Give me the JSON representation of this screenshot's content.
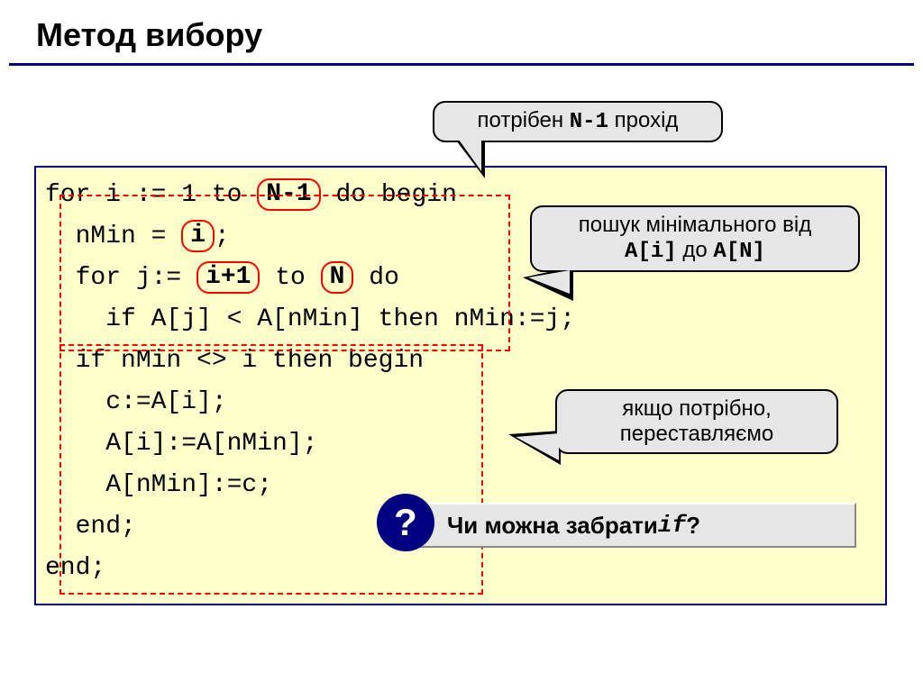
{
  "slide": {
    "title": "Метод вибору"
  },
  "callouts": {
    "top_pre": "потрібен ",
    "top_mono": "N-1",
    "top_post": " прохід",
    "r1_line1": "пошук мінімального від",
    "r1_mono1": "A[i]",
    "r1_mid": " до ",
    "r1_mono2": "A[N]",
    "r2_line1": "якщо потрібно,",
    "r2_line2": "переставляємо"
  },
  "code": {
    "l1a": "for i := 1 to ",
    "l1_pill": "N-1",
    "l1b": " do begin",
    "l2a": "  nMin = ",
    "l2_pill": "i",
    "l2b": ";",
    "l3a": "  for j:= ",
    "l3_pill1": "i+1",
    "l3_mid": " to ",
    "l3_pill2": "N",
    "l3b": " do",
    "l4": "    if A[j] < A[nMin] then nMin:=j;",
    "l5": "  if nMin <> i then begin",
    "l6": "    c:=A[i];",
    "l7": "    A[i]:=A[nMin];",
    "l8": "    A[nMin]:=c;",
    "l9": "  end;",
    "l10": "end;"
  },
  "question": {
    "badge": "?",
    "pre": "Чи можна забрати ",
    "mono": "if",
    "post": "?"
  }
}
